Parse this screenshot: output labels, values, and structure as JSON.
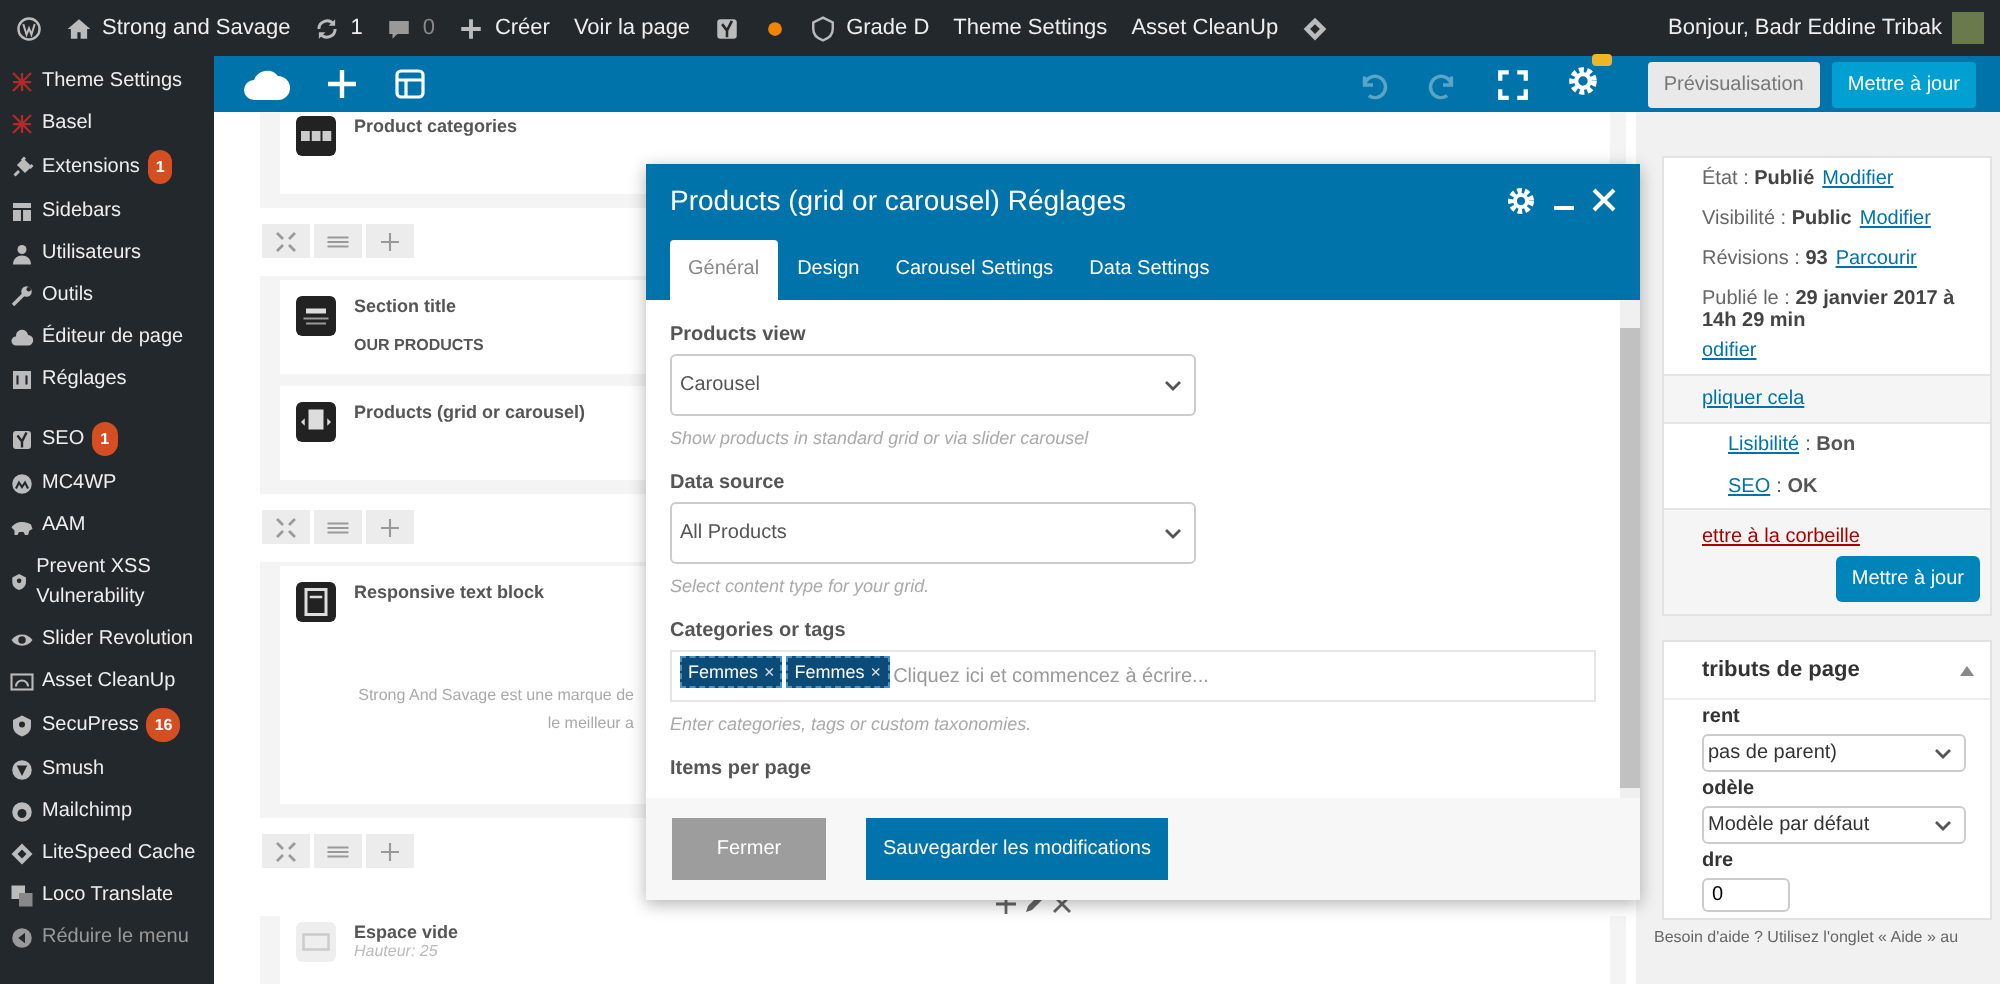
{
  "admin_bar": {
    "items": [
      {
        "kind": "wp"
      },
      {
        "kind": "home",
        "label": "Strong and Savage"
      },
      {
        "kind": "updates",
        "label": "1"
      },
      {
        "kind": "comments",
        "label": "0"
      },
      {
        "kind": "new",
        "label": "Créer"
      },
      {
        "kind": "text",
        "label": "Voir la page"
      },
      {
        "kind": "yoast"
      },
      {
        "kind": "dot"
      },
      {
        "kind": "grade",
        "label": "Grade D"
      },
      {
        "kind": "text",
        "label": "Theme Settings"
      },
      {
        "kind": "text",
        "label": "Asset CleanUp"
      },
      {
        "kind": "diamond"
      }
    ],
    "greeting": "Bonjour, Badr Eddine Tribak"
  },
  "sidebar": {
    "items": [
      {
        "label": "Theme Settings"
      },
      {
        "label": "Basel"
      },
      {
        "label": "Extensions",
        "badge": "1"
      },
      {
        "label": "Sidebars"
      },
      {
        "label": "Utilisateurs"
      },
      {
        "label": "Outils"
      },
      {
        "label": "Éditeur de page"
      },
      {
        "label": "Réglages"
      },
      {
        "label": "SEO",
        "badge": "1"
      },
      {
        "label": "MC4WP"
      },
      {
        "label": "AAM"
      },
      {
        "label": "Prevent XSS Vulnerability"
      },
      {
        "label": "Slider Revolution"
      },
      {
        "label": "Asset CleanUp"
      },
      {
        "label": "SecuPress",
        "badge": "16"
      },
      {
        "label": "Smush"
      },
      {
        "label": "Mailchimp"
      },
      {
        "label": "LiteSpeed Cache"
      },
      {
        "label": "Loco Translate"
      }
    ],
    "collapse": "Réduire le menu"
  },
  "builder_bar": {
    "tools": [
      {
        "disabled": true
      },
      {
        "disabled": true
      },
      {
        "disabled": false
      },
      {
        "disabled": false
      }
    ],
    "buttons": [
      {
        "label": "Prévisualisation",
        "kind": "secondary"
      },
      {
        "label": "Mettre à jour",
        "kind": "primary"
      }
    ]
  },
  "builder": {
    "blocks": [
      {
        "kind": "section",
        "elements": [
          {
            "title": "Product categories"
          }
        ]
      },
      {
        "kind": "controls"
      },
      {
        "kind": "section",
        "elements": [
          {
            "title": "Section title",
            "subtitle": "OUR PRODUCTS"
          },
          {
            "title": "Products (grid or carousel)"
          }
        ]
      },
      {
        "kind": "controls"
      },
      {
        "kind": "section",
        "elements": [
          {
            "title": "Responsive text block",
            "preview": [
              "Strong And Savage est une marque de",
              "le meilleur a"
            ]
          }
        ]
      },
      {
        "kind": "controls"
      },
      {
        "kind": "element_actions"
      },
      {
        "kind": "section",
        "elements": [
          {
            "title": "Espace vide",
            "note": "Hauteur: 25"
          }
        ]
      }
    ]
  },
  "modal": {
    "title": "Products (grid or carousel) Réglages",
    "tabs": [
      {
        "label": "Général",
        "selected": true
      },
      {
        "label": "Design",
        "selected": false
      },
      {
        "label": "Carousel Settings",
        "selected": false
      },
      {
        "label": "Data Settings",
        "selected": false
      }
    ],
    "fields": [
      {
        "kind": "select",
        "label": "Products view",
        "value": "Carousel",
        "help": "Show products in standard grid or via slider carousel"
      },
      {
        "kind": "select",
        "label": "Data source",
        "value": "All Products",
        "help": "Select content type for your grid."
      },
      {
        "kind": "tags",
        "label": "Categories or tags",
        "tags": [
          {
            "label": "Femmes",
            "remove": "×"
          },
          {
            "label": "Femmes",
            "remove": "×"
          }
        ],
        "placeholder": "Cliquez ici et commencez à écrire...",
        "help": "Enter categories, tags or custom taxonomies."
      },
      {
        "kind": "heading",
        "label": "Items per page"
      }
    ],
    "buttons": [
      {
        "label": "Fermer",
        "kind": "secondary"
      },
      {
        "label": "Sauvegarder les modifications",
        "kind": "primary"
      }
    ]
  },
  "publish_box": {
    "rows": [
      {
        "label": "État : **Publié**",
        "link": "Modifier"
      },
      {
        "label": "Visibilité : **Public**",
        "link": "Modifier"
      },
      {
        "label": "Révisions : **93**",
        "link": "Parcourir"
      },
      {
        "label": "Publié le : **29 janvier 2017 à 14h 29 min**"
      }
    ],
    "cut_link": "odifier",
    "explain_link": "pliquer cela",
    "seo_rows": [
      {
        "link": "Lisibilité",
        "value": ": **Bon**"
      },
      {
        "link": "SEO",
        "value": ": **OK**"
      }
    ],
    "trash_link": "ettre à la corbeille",
    "button": "Mettre à jour"
  },
  "attributes_box": {
    "title": "tributs de page",
    "expanded": true,
    "fields": [
      {
        "kind": "select",
        "label": "rent",
        "value": "pas de parent)"
      },
      {
        "kind": "select",
        "label": "odèle",
        "value": "Modèle par défaut"
      },
      {
        "kind": "input",
        "label": "dre",
        "value": "0"
      }
    ],
    "help": "Besoin d'aide ? Utilisez l'onglet « Aide » au"
  }
}
